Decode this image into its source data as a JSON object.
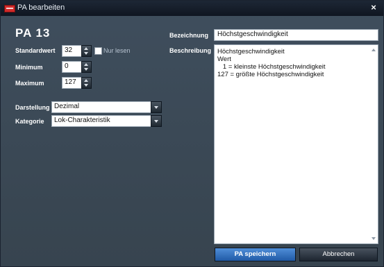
{
  "window": {
    "title": "PA bearbeiten",
    "close_symbol": "×"
  },
  "pa": {
    "label": "PA   13"
  },
  "form": {
    "standardwert_label": "Standardwert",
    "standardwert_value": "32",
    "nur_lesen_label": "Nur lesen",
    "minimum_label": "Minimum",
    "minimum_value": "0",
    "maximum_label": "Maximum",
    "maximum_value": "127",
    "darstellung_label": "Darstellung",
    "darstellung_value": "Dezimal",
    "kategorie_label": "Kategorie",
    "kategorie_value": "Lok-Charakteristik"
  },
  "details": {
    "bezeichnung_label": "Bezeichnung",
    "bezeichnung_value": "Höchstgeschwindigkeit",
    "beschreibung_label": "Beschreibung",
    "beschreibung_lines": [
      "Höchstgeschwindigkeit",
      "Wert",
      "   1 = kleinste Höchstgeschwindigkeit",
      "127 = größte Höchstgeschwindigkeit"
    ]
  },
  "buttons": {
    "save_label": "PA speichern",
    "cancel_label": "Abbrechen"
  },
  "colors": {
    "titlebar": "#131b27",
    "background": "#3c4a58",
    "save_button": "#2d6ab8",
    "app_icon": "#d22a2a"
  },
  "icons": {
    "app": "app-icon",
    "close": "close-icon",
    "spin": "spin-buttons",
    "dropdown": "chevron-down-icon"
  }
}
